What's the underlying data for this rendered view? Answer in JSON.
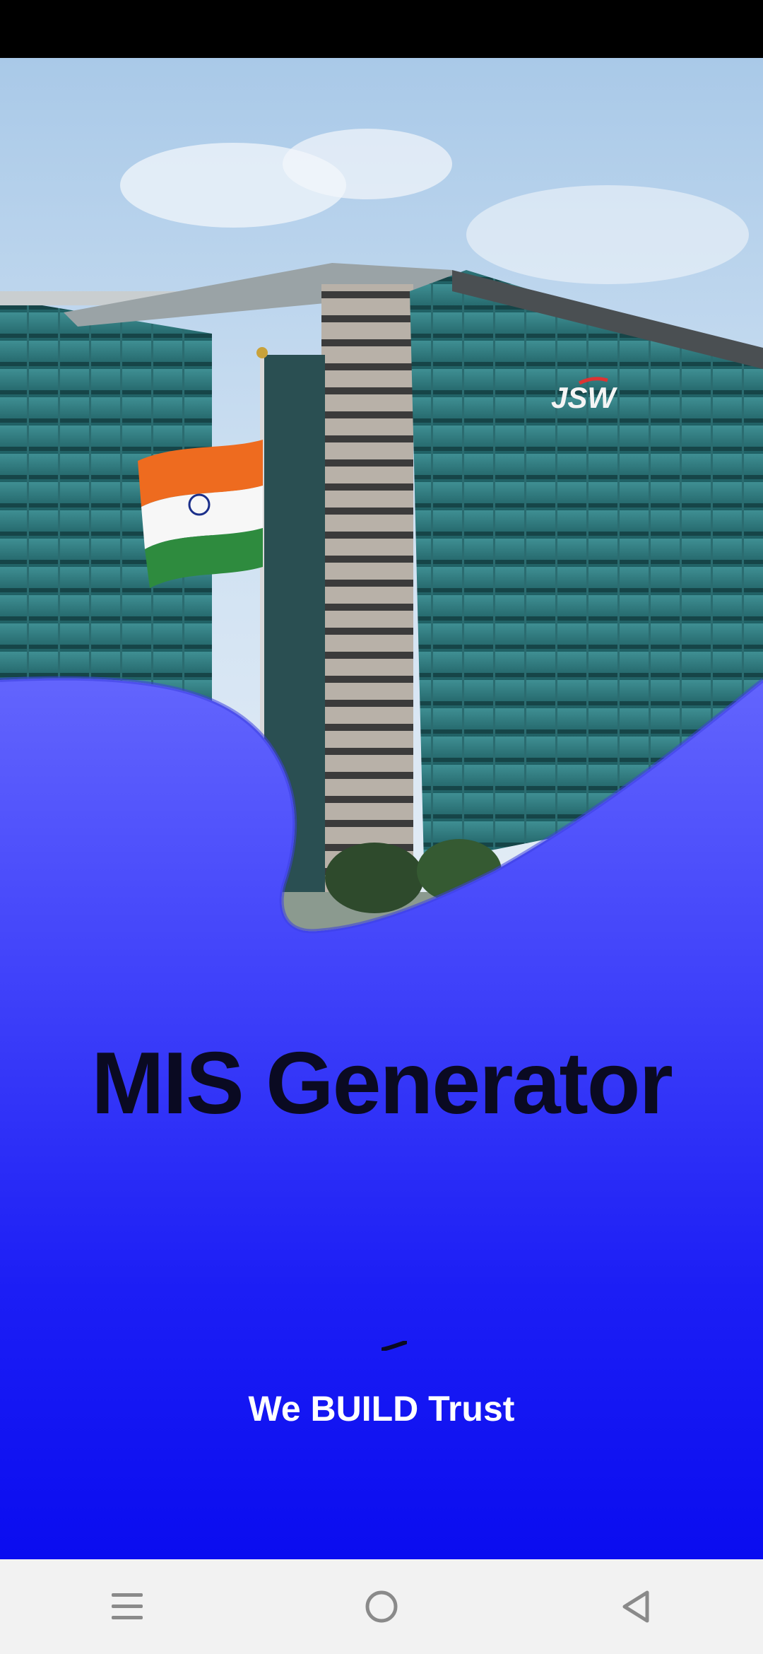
{
  "app": {
    "title": "MIS Generator",
    "tagline": "We BUILD Trust"
  },
  "hero": {
    "image": "building-with-flag-photo",
    "logo_text": "JSW"
  },
  "colors": {
    "gradient_top": "#9a9cff",
    "gradient_bottom": "#0a0cf0",
    "title_color": "#0a0a22",
    "tagline_color": "#ffffff",
    "nav_bar_bg": "#f2f2f2"
  },
  "nav": {
    "menu_icon": "menu-icon",
    "home_icon": "home-circle-icon",
    "back_icon": "back-triangle-icon"
  }
}
